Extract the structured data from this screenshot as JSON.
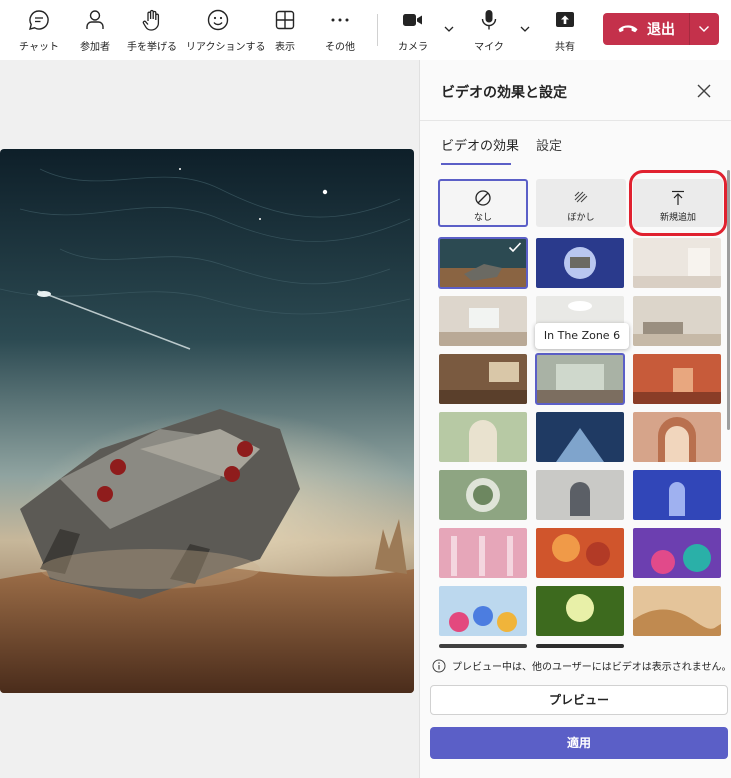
{
  "toolbar": {
    "chat": "チャット",
    "participants": "参加者",
    "raise_hand": "手を挙げる",
    "reactions": "リアクションする",
    "view": "表示",
    "more": "その他",
    "camera": "カメラ",
    "mic": "マイク",
    "share": "共有",
    "leave": "退出"
  },
  "panel": {
    "title": "ビデオの効果と設定",
    "tabs": [
      "ビデオの効果",
      "設定"
    ],
    "effects": [
      {
        "label": "なし",
        "icon": "no-effect-icon"
      },
      {
        "label": "ぼかし",
        "icon": "blur-icon"
      },
      {
        "label": "新規追加",
        "icon": "upload-icon"
      }
    ],
    "tooltip": "In The Zone 6",
    "notice": "プレビュー中は、他のユーザーにはビデオは表示されません。",
    "preview_button": "プレビュー",
    "apply_button": "適用"
  },
  "colors": {
    "accent": "#5b5fc7",
    "leave": "#c4314b",
    "highlight": "#e0212f"
  }
}
